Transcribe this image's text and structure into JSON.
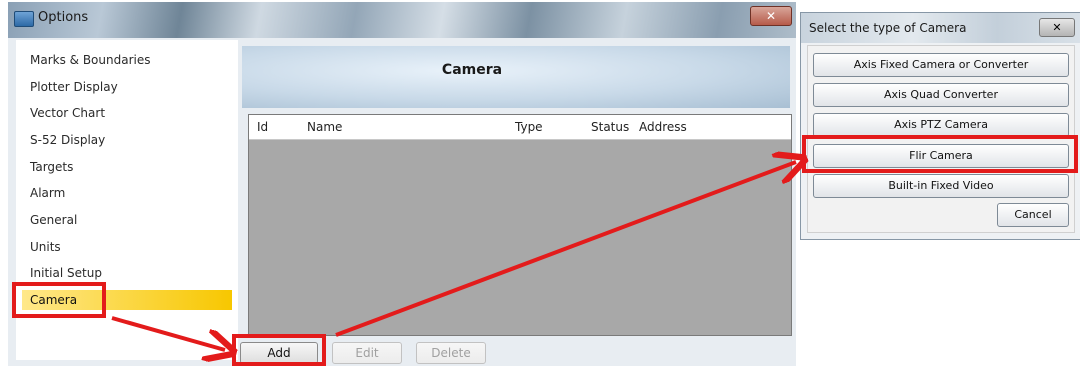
{
  "options_window": {
    "title": "Options",
    "close_glyph": "✕",
    "sidebar": {
      "items": [
        {
          "label": "Marks & Boundaries"
        },
        {
          "label": "Plotter Display"
        },
        {
          "label": "Vector Chart"
        },
        {
          "label": "S-52 Display"
        },
        {
          "label": "Targets"
        },
        {
          "label": "Alarm"
        },
        {
          "label": "General"
        },
        {
          "label": "Units"
        },
        {
          "label": "Initial Setup"
        },
        {
          "label": "Camera",
          "selected": true
        }
      ]
    },
    "main": {
      "heading": "Camera",
      "table": {
        "columns": [
          "Id",
          "Name",
          "Type",
          "Status",
          "Address"
        ],
        "rows": []
      },
      "buttons": {
        "add": "Add",
        "edit": "Edit",
        "delete": "Delete"
      }
    }
  },
  "camera_dialog": {
    "title": "Select the type of Camera",
    "close_glyph": "✕",
    "options": [
      "Axis Fixed Camera or Converter",
      "Axis Quad Converter",
      "Axis PTZ Camera",
      "Flir Camera",
      "Built-in Fixed Video"
    ],
    "cancel": "Cancel"
  },
  "colors": {
    "annotation": "#e31b1b",
    "selected_item": "#f7c700"
  }
}
